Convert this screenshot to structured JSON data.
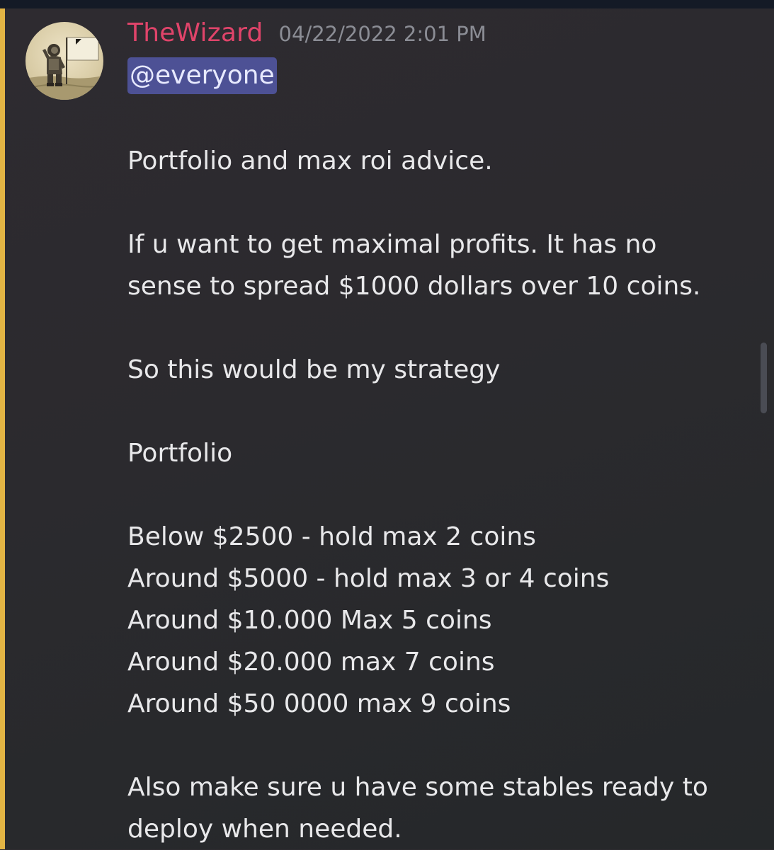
{
  "colors": {
    "username": "#e0446a",
    "mention_bg": "#4d5195",
    "mention_text": "#e7e9ff",
    "mention_bar": "#e2b444",
    "timestamp": "#8b8d95",
    "text": "#e8e8ea",
    "topbar": "#141a26"
  },
  "message": {
    "avatar_icon": "astronaut-flag-avatar",
    "username": "TheWizard",
    "timestamp": "04/22/2022 2:01 PM",
    "mention": "@everyone",
    "lines": [
      "Portfolio and max roi advice.",
      "",
      "If u want to get maximal profits. It has no",
      "sense to spread $1000 dollars over 10 coins.",
      "",
      "So this would be my strategy",
      "",
      "Portfolio",
      "",
      "Below $2500 - hold max 2 coins",
      "Around $5000 - hold max 3 or 4 coins",
      "Around $10.000 Max 5 coins",
      "Around $20.000 max 7 coins",
      "Around $50 0000 max 9 coins",
      "",
      "Also make sure u have some stables ready to",
      "deploy when needed."
    ]
  }
}
